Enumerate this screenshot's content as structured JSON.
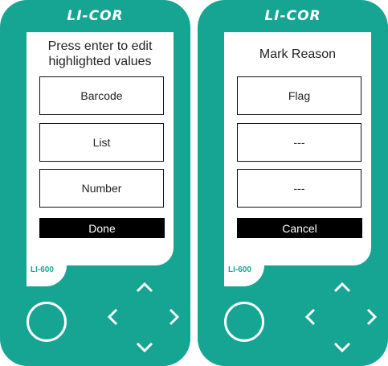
{
  "devices": [
    {
      "logo": "LI-COR",
      "model": "LI-600",
      "title_lines": [
        "Press enter to edit",
        "highlighted values"
      ],
      "options": [
        "Barcode",
        "List",
        "Number"
      ],
      "action": "Done"
    },
    {
      "logo": "LI-COR",
      "model": "LI-600",
      "title_lines": [
        "Mark Reason"
      ],
      "options": [
        "Flag",
        "---",
        "---"
      ],
      "action": "Cancel"
    }
  ],
  "colors": {
    "body": "#17a593",
    "screen": "#ffffff",
    "button": "#000000"
  },
  "icons": {
    "power": "power-button-icon",
    "up": "chevron-up-icon",
    "left": "chevron-left-icon",
    "right": "chevron-right-icon",
    "down": "chevron-down-icon"
  }
}
